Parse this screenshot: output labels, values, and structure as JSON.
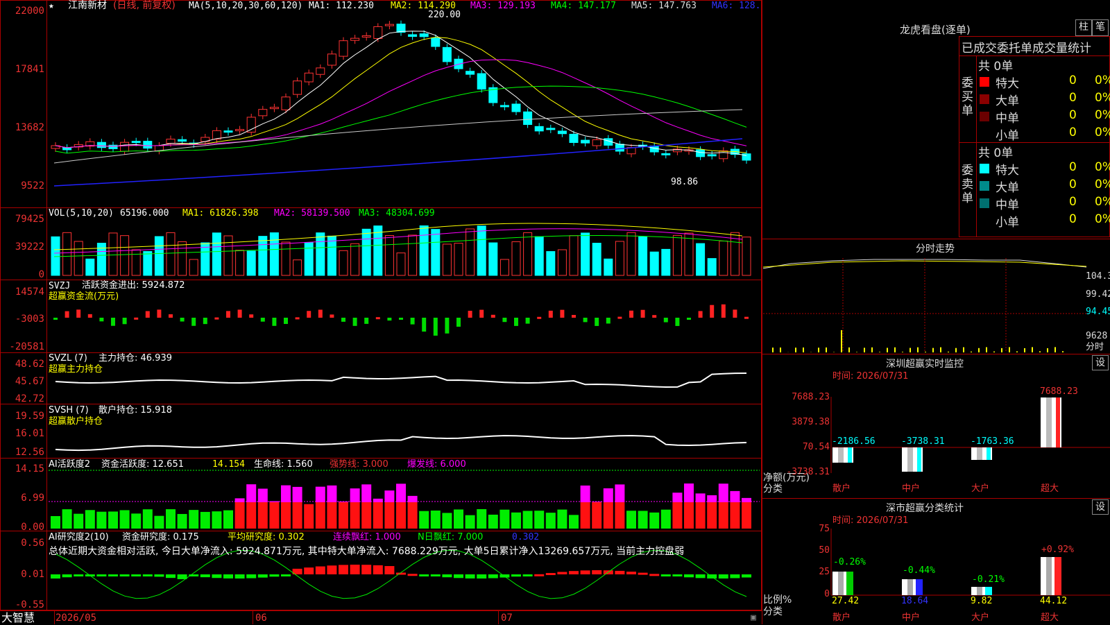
{
  "app_name": "大智慧",
  "stock_name": "江南新材",
  "period_label": "(日线, 前复权)",
  "ma_header": {
    "params": "MA(5,10,20,30,60,120)",
    "ma1": "MA1: 112.230",
    "ma2": "MA2: 114.290",
    "ma3": "MA3: 129.193",
    "ma4": "MA4: 147.177",
    "ma5": "MA5: 147.763",
    "ma6": "MA6: 128."
  },
  "price_axis": [
    "22000",
    "17841",
    "13682",
    "9522"
  ],
  "price_high_label": "220.00",
  "price_low_label": "98.86",
  "vol_header": {
    "params": "VOL(5,10,20)",
    "vol": "65196.000",
    "ma1": "MA1: 61826.398",
    "ma2": "MA2: 58139.500",
    "ma3": "MA3: 48304.699"
  },
  "vol_axis": [
    "79425",
    "39222",
    "0"
  ],
  "svzj": {
    "name": "SVZJ",
    "label": "活跃资金进出: 5924.872",
    "subtitle": "超赢资金流(万元)",
    "axis": [
      "14574",
      "-3003",
      "-20581"
    ]
  },
  "svzl": {
    "name": "SVZL (7)",
    "label": "主力持仓: 46.939",
    "subtitle": "超赢主力持仓",
    "axis": [
      "48.62",
      "45.67",
      "42.72"
    ]
  },
  "svsh": {
    "name": "SVSH (7)",
    "label": "散户持仓: 15.918",
    "subtitle": "超赢散户持仓",
    "axis": [
      "19.59",
      "16.01",
      "12.56"
    ]
  },
  "active": {
    "name": "AI活跃度2",
    "label": "资金活跃度: 12.651",
    "v2": "14.154",
    "life": "生命线: 1.560",
    "strong": "强势线: 3.000",
    "burst": "爆发线: 6.000",
    "axis": [
      "14.15",
      "6.99",
      "0.00"
    ]
  },
  "research": {
    "name": "AI研究度2(10)",
    "label": "资金研究度: 0.175",
    "avg": "平均研究度: 0.302",
    "cont": "连续飘红: 1.000",
    "nday": "N日飘红: 7.000",
    "last": "0.302",
    "summary": "总体近期大资金相对活跃, 今日大单净流入: 5924.871万元, 其中特大单净流入: 7688.229万元, 大单5日累计净入13269.657万元, 当前主力控盘弱",
    "axis": [
      "0.56",
      "0.01",
      "-0.55"
    ]
  },
  "date_axis": [
    "2026/05",
    "06",
    "07"
  ],
  "right": {
    "dragon_title": "龙虎看盘(逐单)",
    "btn_zhu": "柱",
    "btn_bi": "笔",
    "section_title": "已成交委托单成交量统计",
    "buy_label": "委买单",
    "sell_label": "委卖单",
    "buy_total": "共 0单",
    "sell_total": "共 0单",
    "buy_rows": [
      {
        "name": "特大",
        "count": "0",
        "pct": "0%",
        "color": "#ff0000"
      },
      {
        "name": "大单",
        "count": "0",
        "pct": "0%",
        "color": "#8b0000"
      },
      {
        "name": "中单",
        "count": "0",
        "pct": "0%",
        "color": "#6b0000"
      },
      {
        "name": "小单",
        "count": "0",
        "pct": "0%",
        "color": "#000000"
      }
    ],
    "sell_rows": [
      {
        "name": "特大",
        "count": "0",
        "pct": "0%",
        "color": "#00ffff"
      },
      {
        "name": "大单",
        "count": "0",
        "pct": "0%",
        "color": "#008b8b"
      },
      {
        "name": "中单",
        "count": "0",
        "pct": "0%",
        "color": "#007070"
      },
      {
        "name": "小单",
        "count": "0",
        "pct": "0%",
        "color": "#000000"
      }
    ],
    "intraday_title": "分时走势",
    "intraday_axis": [
      "104.3",
      "99.42",
      "94.45",
      "9628",
      "分时"
    ],
    "sz_monitor_title": "深圳超赢实时监控",
    "btn_set": "设",
    "time1": "时间: 2026/07/31",
    "monitor_axis": [
      "7688.23",
      "3879.38",
      "70.54",
      "-3738.31"
    ],
    "monitor_bars": [
      {
        "label": "散户",
        "value": "-2186.56"
      },
      {
        "label": "中户",
        "value": "-3738.31"
      },
      {
        "label": "大户",
        "value": "-1763.36"
      },
      {
        "label": "超大",
        "value": "7688.23"
      }
    ],
    "net_label": "净额(万元)",
    "class_label": "分类",
    "classify_title": "深市超赢分类统计",
    "time2": "时间: 2026/07/31",
    "class_axis": [
      "75",
      "50",
      "25",
      "0"
    ],
    "class_bars": [
      {
        "label": "散户",
        "change": "-0.26%",
        "value": "27.42"
      },
      {
        "label": "中户",
        "change": "-0.44%",
        "value": "18.64"
      },
      {
        "label": "大户",
        "change": "-0.21%",
        "value": "9.82"
      },
      {
        "label": "超大",
        "change": "+0.92%",
        "value": "44.12"
      }
    ],
    "ratio_label": "比例%",
    "class_label2": "分类"
  }
}
